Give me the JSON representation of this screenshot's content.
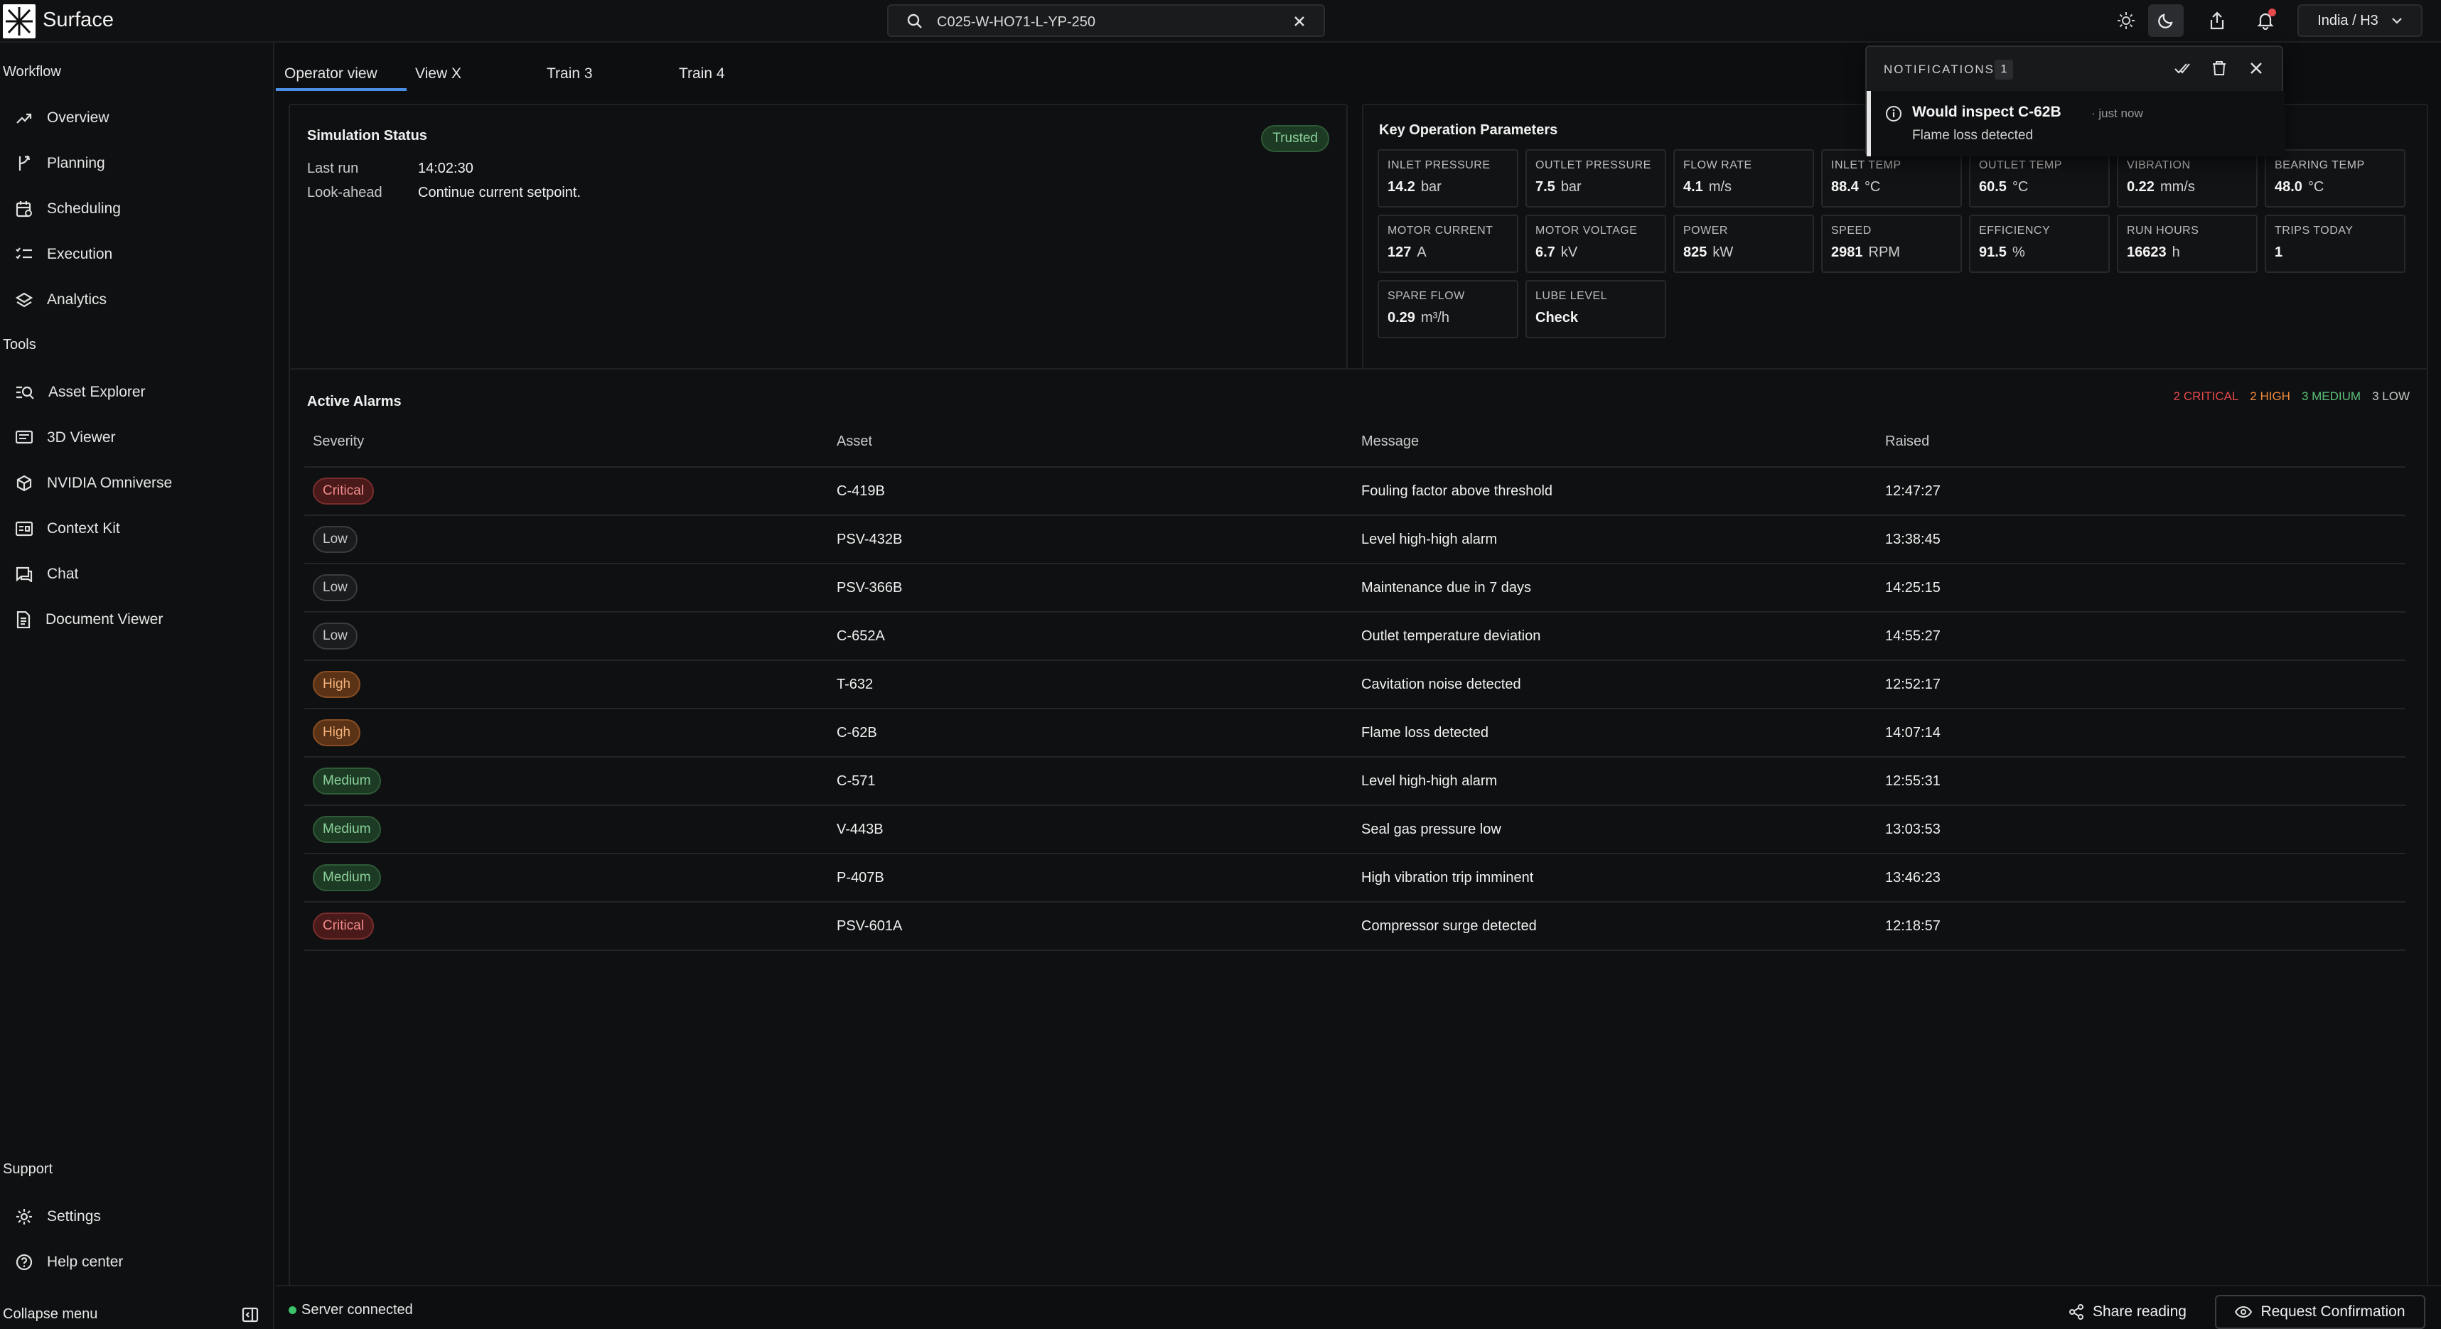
{
  "app": {
    "name": "Surface"
  },
  "search": {
    "value": "C025-W-HO71-L-YP-250"
  },
  "region": {
    "label": "India / H3"
  },
  "sidebar": {
    "workflow_label": "Workflow",
    "workflow": [
      {
        "label": "Overview",
        "icon": "trend-icon"
      },
      {
        "label": "Planning",
        "icon": "branch-icon"
      },
      {
        "label": "Scheduling",
        "icon": "calendar-icon"
      },
      {
        "label": "Execution",
        "icon": "list-check-icon"
      },
      {
        "label": "Analytics",
        "icon": "layers-icon"
      }
    ],
    "tools_label": "Tools",
    "tools": [
      {
        "label": "Asset Explorer",
        "icon": "search-list-icon"
      },
      {
        "label": "3D Viewer",
        "icon": "monitor-icon"
      },
      {
        "label": "NVIDIA Omniverse",
        "icon": "cube-icon"
      },
      {
        "label": "Context Kit",
        "icon": "kit-icon"
      },
      {
        "label": "Chat",
        "icon": "chat-icon"
      },
      {
        "label": "Document Viewer",
        "icon": "document-icon"
      }
    ],
    "support_label": "Support",
    "support": [
      {
        "label": "Settings",
        "icon": "gear-icon"
      },
      {
        "label": "Help center",
        "icon": "help-icon"
      }
    ],
    "collapse_label": "Collapse menu"
  },
  "tabs": [
    "Operator view",
    "View X",
    "Train 3",
    "Train 4"
  ],
  "simulation": {
    "title": "Simulation Status",
    "badge": "Trusted",
    "last_run_label": "Last run",
    "last_run": "14:02:30",
    "lookahead_label": "Look-ahead",
    "lookahead": "Continue current setpoint."
  },
  "params": {
    "title": "Key Operation Parameters",
    "items": [
      {
        "label": "INLET PRESSURE",
        "value": "14.2",
        "unit": "bar"
      },
      {
        "label": "OUTLET PRESSURE",
        "value": "7.5",
        "unit": "bar"
      },
      {
        "label": "FLOW RATE",
        "value": "4.1",
        "unit": "m/s"
      },
      {
        "label": "INLET TEMP",
        "value": "88.4",
        "unit": "°C"
      },
      {
        "label": "OUTLET TEMP",
        "value": "60.5",
        "unit": "°C"
      },
      {
        "label": "VIBRATION",
        "value": "0.22",
        "unit": "mm/s"
      },
      {
        "label": "BEARING TEMP",
        "value": "48.0",
        "unit": "°C"
      },
      {
        "label": "MOTOR CURRENT",
        "value": "127",
        "unit": "A"
      },
      {
        "label": "MOTOR VOLTAGE",
        "value": "6.7",
        "unit": "kV"
      },
      {
        "label": "POWER",
        "value": "825",
        "unit": "kW"
      },
      {
        "label": "SPEED",
        "value": "2981",
        "unit": "RPM"
      },
      {
        "label": "EFFICIENCY",
        "value": "91.5",
        "unit": "%"
      },
      {
        "label": "RUN HOURS",
        "value": "16623",
        "unit": "h"
      },
      {
        "label": "TRIPS TODAY",
        "value": "1",
        "unit": ""
      },
      {
        "label": "SPARE FLOW",
        "value": "0.29",
        "unit": "m³/h"
      },
      {
        "label": "LUBE LEVEL",
        "value": "Check",
        "unit": ""
      }
    ]
  },
  "alarms": {
    "title": "Active Alarms",
    "legend": [
      {
        "text": "2 CRITICAL",
        "color": "#e5484d"
      },
      {
        "text": "2 HIGH",
        "color": "#f08a3c"
      },
      {
        "text": "3 MEDIUM",
        "color": "#5bc07a"
      },
      {
        "text": "3 LOW",
        "color": "#c9c9c9"
      }
    ],
    "columns": [
      "Severity",
      "Asset",
      "Message",
      "Raised"
    ],
    "rows": [
      {
        "severity": "Critical",
        "asset": "C-419B",
        "message": "Fouling factor above threshold",
        "raised": "12:47:27"
      },
      {
        "severity": "Low",
        "asset": "PSV-432B",
        "message": "Level high-high alarm",
        "raised": "13:38:45"
      },
      {
        "severity": "Low",
        "asset": "PSV-366B",
        "message": "Maintenance due in 7 days",
        "raised": "14:25:15"
      },
      {
        "severity": "Low",
        "asset": "C-652A",
        "message": "Outlet temperature deviation",
        "raised": "14:55:27"
      },
      {
        "severity": "High",
        "asset": "T-632",
        "message": "Cavitation noise detected",
        "raised": "12:52:17"
      },
      {
        "severity": "High",
        "asset": "C-62B",
        "message": "Flame loss detected",
        "raised": "14:07:14"
      },
      {
        "severity": "Medium",
        "asset": "C-571",
        "message": "Level high-high alarm",
        "raised": "12:55:31"
      },
      {
        "severity": "Medium",
        "asset": "V-443B",
        "message": "Seal gas pressure low",
        "raised": "13:03:53"
      },
      {
        "severity": "Medium",
        "asset": "P-407B",
        "message": "High vibration trip imminent",
        "raised": "13:46:23"
      },
      {
        "severity": "Critical",
        "asset": "PSV-601A",
        "message": "Compressor surge detected",
        "raised": "12:18:57"
      }
    ]
  },
  "status": {
    "server": "Server connected",
    "share_label": "Share reading",
    "confirm_label": "Request Confirmation"
  },
  "notifications": {
    "title": "NOTIFICATIONS",
    "count": "1",
    "item": {
      "heading": "Would inspect C-62B",
      "time": "· just now",
      "body": "Flame loss detected"
    }
  }
}
